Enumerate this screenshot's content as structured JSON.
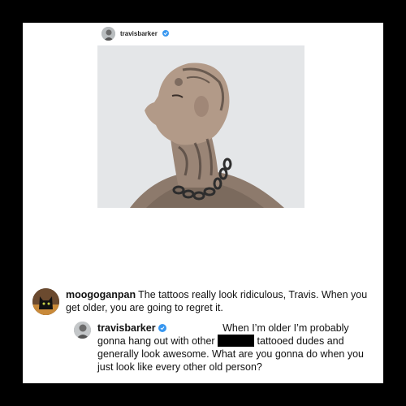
{
  "post": {
    "username": "travisbarker",
    "verified_icon": "verified-badge-icon",
    "photo_icon": "tattooed-man-profile-photo"
  },
  "comments": [
    {
      "username": "moogoganpan",
      "avatar_icon": "black-cat-avatar",
      "text": "The tattoos really look ridiculous, Travis. When you get older, you are going to regret it."
    },
    {
      "username": "travisbarker",
      "avatar_icon": "travisbarker-avatar",
      "text_before_redaction": "When I’m older I’m probably gonna hang out with other",
      "text_after_redaction": "tattooed dudes and generally look awesome. What are you gonna do when you just look like every other old person?"
    }
  ],
  "colors": {
    "verified": "#3897f0",
    "frame": "#000000",
    "card": "#ffffff"
  }
}
